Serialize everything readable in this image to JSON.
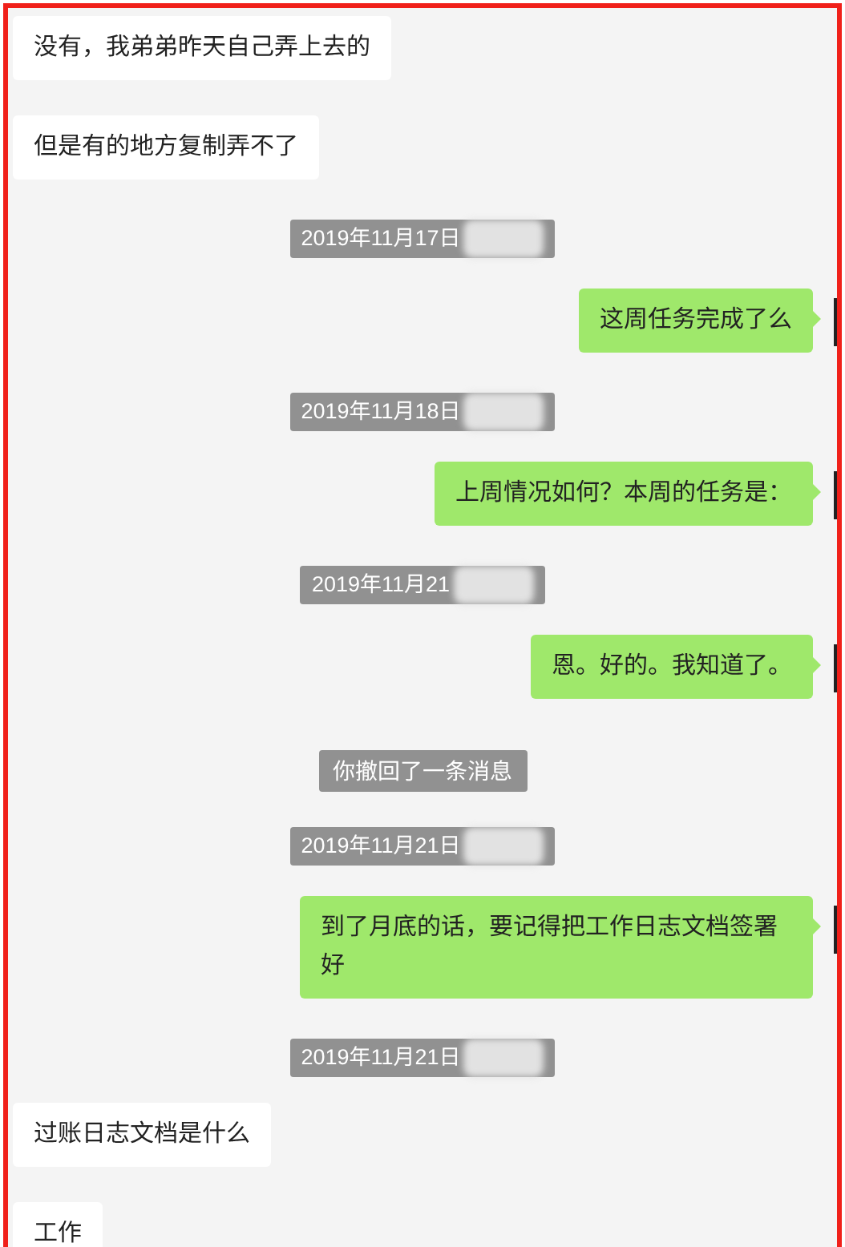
{
  "messages": [
    {
      "kind": "incoming",
      "text": "没有，我弟弟昨天自己弄上去的"
    },
    {
      "kind": "incoming",
      "text": "但是有的地方复制弄不了"
    },
    {
      "kind": "time",
      "text": "2019年11月17日"
    },
    {
      "kind": "outgoing",
      "text": "这周任务完成了么"
    },
    {
      "kind": "time",
      "text": "2019年11月18日"
    },
    {
      "kind": "outgoing",
      "text": "上周情况如何？本周的任务是："
    },
    {
      "kind": "time",
      "text": "2019年11月21"
    },
    {
      "kind": "outgoing",
      "text": "恩。好的。我知道了。"
    },
    {
      "kind": "system",
      "text": "你撤回了一条消息"
    },
    {
      "kind": "time",
      "text": "2019年11月21日"
    },
    {
      "kind": "outgoing",
      "text": "到了月底的话，要记得把工作日志文档签署好"
    },
    {
      "kind": "time",
      "text": "2019年11月21日"
    },
    {
      "kind": "incoming",
      "text": "过账日志文档是什么"
    },
    {
      "kind": "incoming",
      "text": "工作"
    }
  ]
}
